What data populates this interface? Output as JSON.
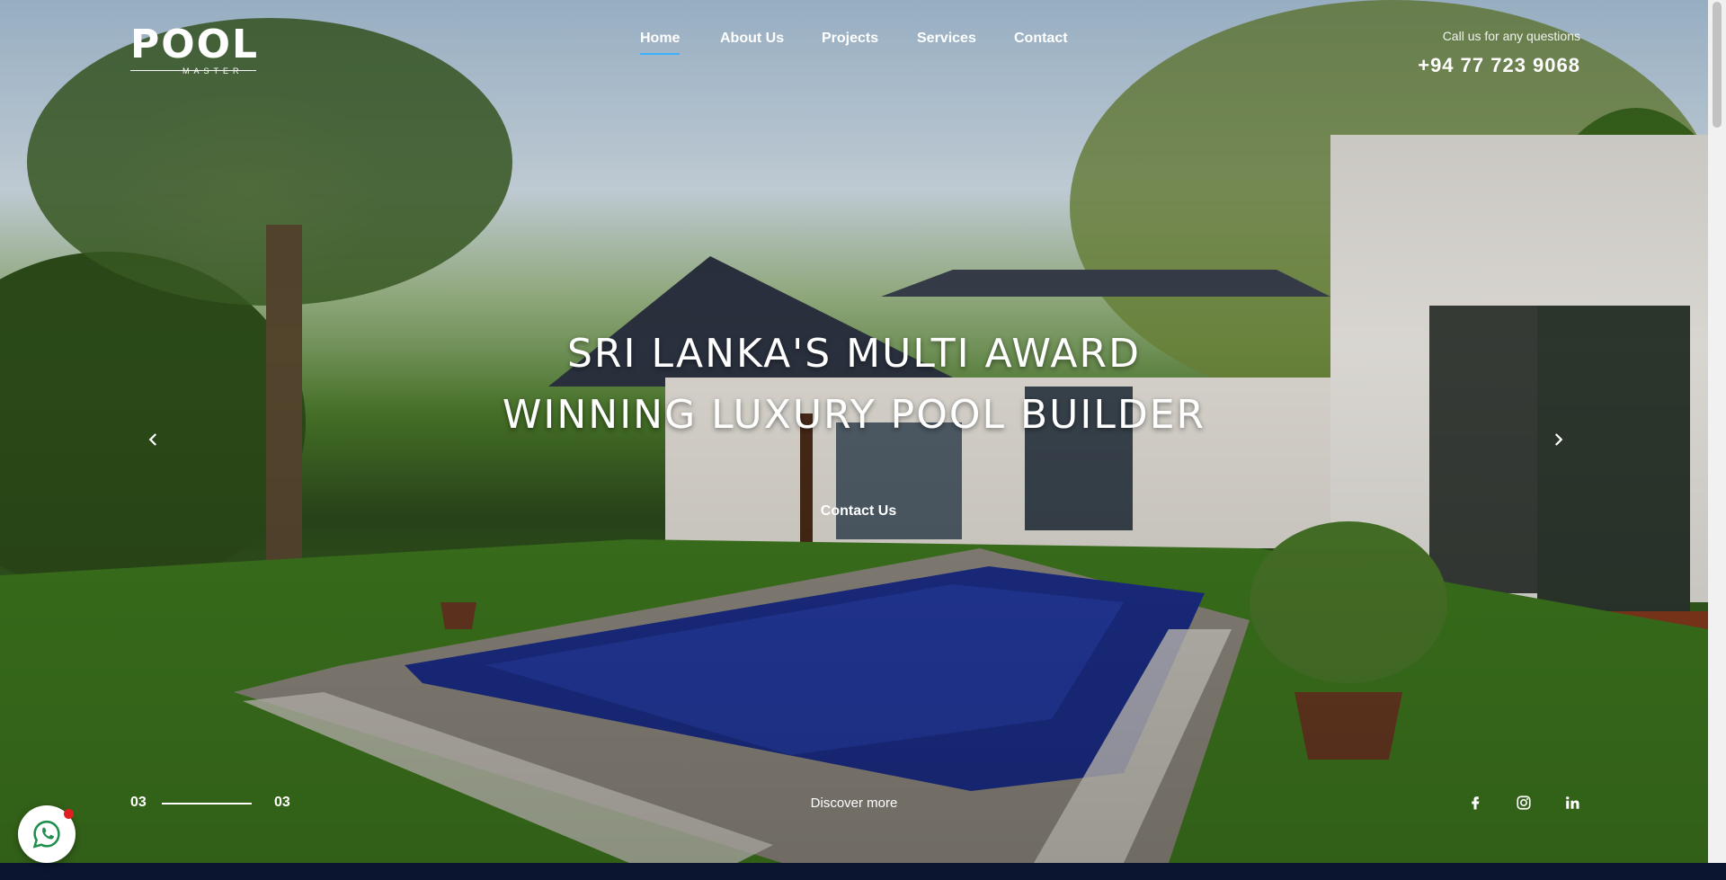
{
  "brand": {
    "logo_text": "POOL",
    "logo_subtext": "MASTER"
  },
  "nav": {
    "items": [
      {
        "label": "Home",
        "active": true
      },
      {
        "label": "About Us",
        "active": false
      },
      {
        "label": "Projects",
        "active": false
      },
      {
        "label": "Services",
        "active": false
      },
      {
        "label": "Contact",
        "active": false
      }
    ]
  },
  "contact": {
    "call_label": "Call us for any questions",
    "phone": "+94 77 723 9068"
  },
  "hero": {
    "headline_line1": "SRI LANKA'S MULTI AWARD",
    "headline_line2": "WINNING LUXURY POOL BUILDER",
    "cta_label": "Contact Us",
    "discover_label": "Discover more",
    "slide_current": "03",
    "slide_total": "03",
    "prev_icon": "chevron-left-icon",
    "next_icon": "chevron-right-icon"
  },
  "social": [
    {
      "name": "facebook-icon"
    },
    {
      "name": "instagram-icon"
    },
    {
      "name": "linkedin-icon"
    }
  ],
  "colors": {
    "accent": "#3bb0ff",
    "footer_bg": "#0b1530",
    "whatsapp": "#25d366"
  }
}
